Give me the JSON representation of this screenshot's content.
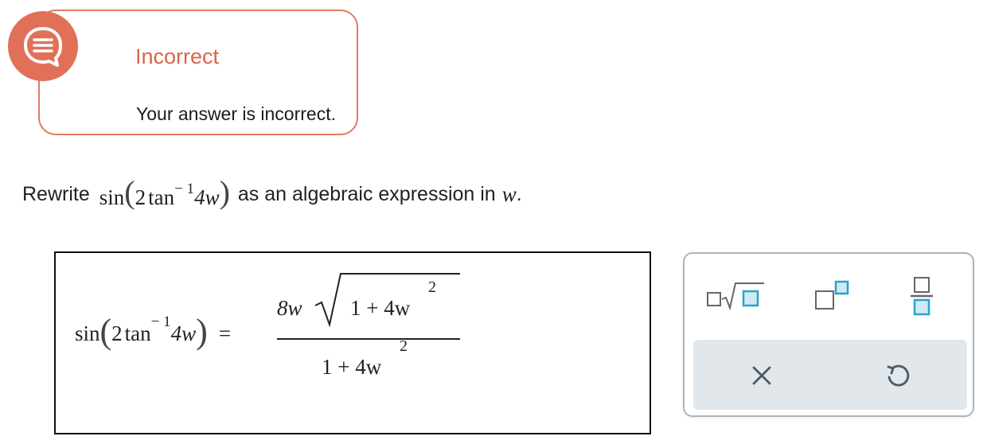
{
  "feedback": {
    "icon": "speech-bubble-icon",
    "title": "Incorrect",
    "message": "Your answer is incorrect.",
    "accent_color": "#e07158"
  },
  "question": {
    "prefix": "Rewrite",
    "func": "sin",
    "inner_coef": "2",
    "inner_func": "tan",
    "inverse_exp": "− 1",
    "arg": "4w",
    "middle": "as an algebraic expression in",
    "variable": "w",
    "suffix": "."
  },
  "answer": {
    "lhs_func": "sin",
    "lhs_coef": "2",
    "lhs_inner": "tan",
    "lhs_exp": "− 1",
    "lhs_arg": "4w",
    "equals": "=",
    "num_coef": "8w",
    "num_radicand": "1 + 4w",
    "num_exp": "2",
    "den": "1 + 4w",
    "den_exp": "2"
  },
  "palette": {
    "buttons": [
      "sqrt-template-icon",
      "exponent-template-icon",
      "fraction-template-icon"
    ],
    "clear_icon": "clear-x-icon",
    "undo_icon": "undo-icon",
    "icon_color": "#2aa3c9"
  }
}
